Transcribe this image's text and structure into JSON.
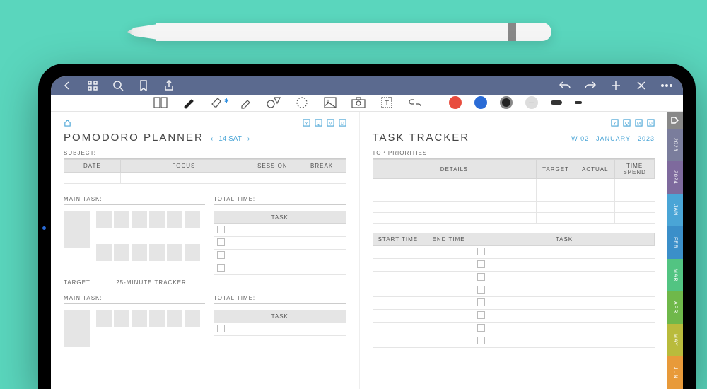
{
  "pomodoro": {
    "title": "POMODORO PLANNER",
    "date_nav": "14 SAT",
    "subject_label": "SUBJECT:",
    "cols": {
      "date": "DATE",
      "focus": "FOCUS",
      "session": "SESSION",
      "break": "BREAK"
    },
    "main_task_label": "MAIN TASK:",
    "total_time_label": "TOTAL TIME:",
    "task_header": "TASK",
    "target_label": "TARGET",
    "tracker_label": "25-MINUTE TRACKER"
  },
  "tracker": {
    "title": "TASK TRACKER",
    "week": "W 02",
    "month": "JANUARY",
    "year": "2023",
    "priorities_label": "TOP PRIORITIES",
    "cols": {
      "details": "DETAILS",
      "target": "TARGET",
      "actual": "ACTUAL",
      "time_spend": "TIME SPEND"
    },
    "cols2": {
      "start": "START TIME",
      "end": "END TIME",
      "task": "TASK"
    }
  },
  "side_tabs": [
    {
      "label": "2023",
      "color": "#7a7d9c"
    },
    {
      "label": "2024",
      "color": "#7e6a9d"
    },
    {
      "label": "JAN",
      "color": "#4aa5d6"
    },
    {
      "label": "FEB",
      "color": "#3b8fc9"
    },
    {
      "label": "MAR",
      "color": "#52c482"
    },
    {
      "label": "APR",
      "color": "#6fb84a"
    },
    {
      "label": "MAY",
      "color": "#b9bb3c"
    },
    {
      "label": "JUN",
      "color": "#e89a3a"
    }
  ],
  "colors": {
    "red": "#e84c3d",
    "blue": "#2a6bd6",
    "black": "#222",
    "gray": "#888"
  }
}
